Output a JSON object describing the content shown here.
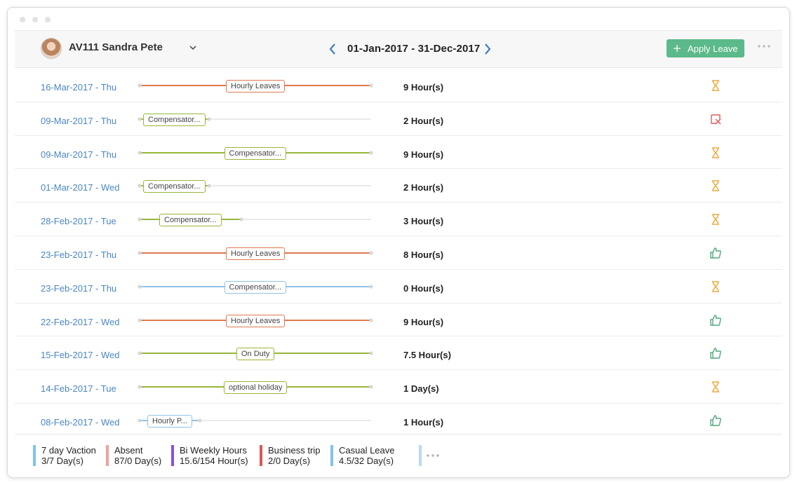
{
  "header": {
    "employee": "AV111 Sandra Pete",
    "date_range": "01-Jan-2017 - 31-Dec-2017",
    "apply_label": "Apply Leave"
  },
  "colors": {
    "orange": "#e0784e",
    "green": "#97b63a",
    "blue": "#8fc3e6",
    "link": "#4a86c5",
    "pending": "#f0a93a",
    "approved": "#4ea97a",
    "rejected": "#e05a5a",
    "button": "#5cb989"
  },
  "rows": [
    {
      "date": "16-Mar-2017 - Thu",
      "tag": "Hourly Leaves",
      "color": "orange",
      "fill": 1.0,
      "hours": "9 Hour(s)",
      "status": "pending"
    },
    {
      "date": "09-Mar-2017 - Thu",
      "tag": "Compensator...",
      "color": "green",
      "fill": 0.3,
      "hours": "2 Hour(s)",
      "status": "rejected"
    },
    {
      "date": "09-Mar-2017 - Thu",
      "tag": "Compensator...",
      "color": "green",
      "fill": 1.0,
      "hours": "9 Hour(s)",
      "status": "pending"
    },
    {
      "date": "01-Mar-2017 - Wed",
      "tag": "Compensator...",
      "color": "green",
      "fill": 0.3,
      "hours": "2 Hour(s)",
      "status": "pending"
    },
    {
      "date": "28-Feb-2017 - Tue",
      "tag": "Compensator...",
      "color": "green",
      "fill": 0.44,
      "hours": "3 Hour(s)",
      "status": "pending"
    },
    {
      "date": "23-Feb-2017 - Thu",
      "tag": "Hourly Leaves",
      "color": "orange",
      "fill": 1.0,
      "hours": "8 Hour(s)",
      "status": "approved"
    },
    {
      "date": "23-Feb-2017 - Thu",
      "tag": "Compensator...",
      "color": "blue",
      "fill": 1.0,
      "hours": "0 Hour(s)",
      "status": "pending"
    },
    {
      "date": "22-Feb-2017 - Wed",
      "tag": "Hourly Leaves",
      "color": "orange",
      "fill": 1.0,
      "hours": "9 Hour(s)",
      "status": "approved"
    },
    {
      "date": "15-Feb-2017 - Wed",
      "tag": "On Duty",
      "color": "green",
      "fill": 1.0,
      "hours": "7.5 Hour(s)",
      "status": "approved"
    },
    {
      "date": "14-Feb-2017 - Tue",
      "tag": "optional holiday",
      "color": "green",
      "fill": 1.0,
      "hours": "1 Day(s)",
      "status": "pending"
    },
    {
      "date": "08-Feb-2017 - Wed",
      "tag": "Hourly P...",
      "color": "blue",
      "fill": 0.26,
      "hours": "1 Hour(s)",
      "status": "approved"
    }
  ],
  "legend": [
    {
      "name": "7 day Vaction",
      "value": "3/7 Day(s)",
      "color": "#7fc4ea"
    },
    {
      "name": "Absent",
      "value": "87/0 Day(s)",
      "color": "#e7a3a0"
    },
    {
      "name": "Bi Weekly Hours",
      "value": "15.6/154 Hour(s)",
      "color": "#8b4ee0"
    },
    {
      "name": "Business trip",
      "value": "2/0 Day(s)",
      "color": "#dc5752"
    },
    {
      "name": "Casual Leave",
      "value": "4.5/32 Day(s)",
      "color": "#7fc4ea"
    }
  ]
}
